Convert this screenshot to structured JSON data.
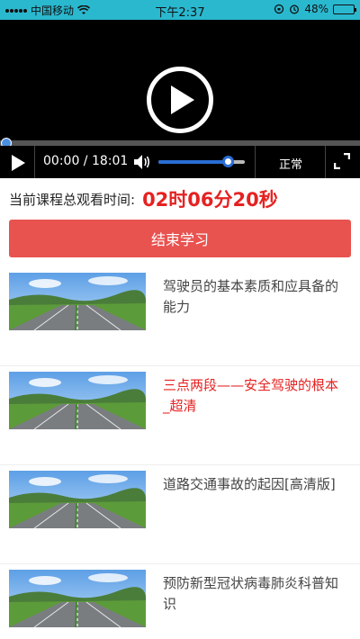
{
  "status_bar": {
    "carrier": "中国移动",
    "time": "下午2:37",
    "battery": "48%",
    "battery_level": 0.48
  },
  "player": {
    "current_time": "00:00",
    "separator": " / ",
    "duration": "18:01",
    "rate_label": "正常",
    "progress_fraction": 0.0,
    "volume_fraction": 0.8,
    "accent_color": "#2a6dd4"
  },
  "watch_time": {
    "label": "当前课程总观看时间:",
    "value": "02时06分20秒",
    "value_color": "#e62121"
  },
  "end_button": {
    "label": "结束学习",
    "color": "#e8524f"
  },
  "courses": [
    {
      "title": "驾驶员的基本素质和应具备的能力",
      "active": false
    },
    {
      "title": "三点两段——安全驾驶的根本_超清",
      "active": true
    },
    {
      "title": "道路交通事故的起因[高清版]",
      "active": false
    },
    {
      "title": "预防新型冠状病毒肺炎科普知识",
      "active": false
    }
  ]
}
